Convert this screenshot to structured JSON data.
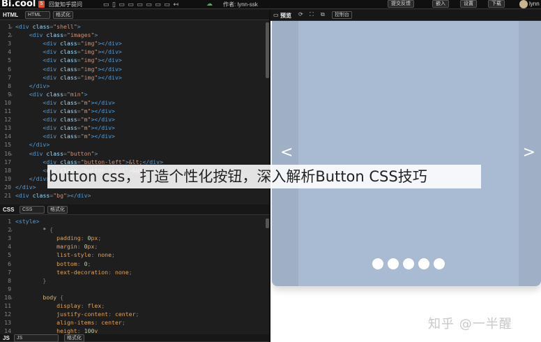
{
  "topbar": {
    "logo": "Bi.cool",
    "html5_badge": "5",
    "project_title": "回复知乎提问",
    "toolbar_glyphs": "▭ ▯ ▭ ▭ ▭ ▭ ▭ ▭ ↤",
    "author": "作者: lynn-ssk",
    "feedback_button": "提交反馈",
    "embed_button": "嵌入",
    "settings_button": "设置",
    "download_button": "下载",
    "username": "lynn"
  },
  "html_panel": {
    "label": "HTML",
    "lang_select": "HTML",
    "format_button": "格式化",
    "lines": [
      [
        [
          "tag",
          "<div "
        ],
        [
          "attr",
          "class"
        ],
        [
          "punc",
          "="
        ],
        [
          "str",
          "\"shell\""
        ],
        [
          "tag",
          ">"
        ]
      ],
      [
        [
          "tag",
          "    <div "
        ],
        [
          "attr",
          "class"
        ],
        [
          "punc",
          "="
        ],
        [
          "str",
          "\"images\""
        ],
        [
          "tag",
          ">"
        ]
      ],
      [
        [
          "tag",
          "        <div "
        ],
        [
          "attr",
          "class"
        ],
        [
          "punc",
          "="
        ],
        [
          "str",
          "\"img\""
        ],
        [
          "tag",
          "></div>"
        ]
      ],
      [
        [
          "tag",
          "        <div "
        ],
        [
          "attr",
          "class"
        ],
        [
          "punc",
          "="
        ],
        [
          "str",
          "\"img\""
        ],
        [
          "tag",
          "></div>"
        ]
      ],
      [
        [
          "tag",
          "        <div "
        ],
        [
          "attr",
          "class"
        ],
        [
          "punc",
          "="
        ],
        [
          "str",
          "\"img\""
        ],
        [
          "tag",
          "></div>"
        ]
      ],
      [
        [
          "tag",
          "        <div "
        ],
        [
          "attr",
          "class"
        ],
        [
          "punc",
          "="
        ],
        [
          "str",
          "\"img\""
        ],
        [
          "tag",
          "></div>"
        ]
      ],
      [
        [
          "tag",
          "        <div "
        ],
        [
          "attr",
          "class"
        ],
        [
          "punc",
          "="
        ],
        [
          "str",
          "\"img\""
        ],
        [
          "tag",
          "></div>"
        ]
      ],
      [
        [
          "tag",
          "    </div>"
        ]
      ],
      [
        [
          "tag",
          "    <div "
        ],
        [
          "attr",
          "class"
        ],
        [
          "punc",
          "="
        ],
        [
          "str",
          "\"min\""
        ],
        [
          "tag",
          ">"
        ]
      ],
      [
        [
          "tag",
          "        <div "
        ],
        [
          "attr",
          "class"
        ],
        [
          "punc",
          "="
        ],
        [
          "str",
          "\"m\""
        ],
        [
          "tag",
          "></div>"
        ]
      ],
      [
        [
          "tag",
          "        <div "
        ],
        [
          "attr",
          "class"
        ],
        [
          "punc",
          "="
        ],
        [
          "str",
          "\"m\""
        ],
        [
          "tag",
          "></div>"
        ]
      ],
      [
        [
          "tag",
          "        <div "
        ],
        [
          "attr",
          "class"
        ],
        [
          "punc",
          "="
        ],
        [
          "str",
          "\"m\""
        ],
        [
          "tag",
          "></div>"
        ]
      ],
      [
        [
          "tag",
          "        <div "
        ],
        [
          "attr",
          "class"
        ],
        [
          "punc",
          "="
        ],
        [
          "str",
          "\"m\""
        ],
        [
          "tag",
          "></div>"
        ]
      ],
      [
        [
          "tag",
          "        <div "
        ],
        [
          "attr",
          "class"
        ],
        [
          "punc",
          "="
        ],
        [
          "str",
          "\"m\""
        ],
        [
          "tag",
          "></div>"
        ]
      ],
      [
        [
          "tag",
          "    </div>"
        ]
      ],
      [
        [
          "tag",
          "    <div "
        ],
        [
          "attr",
          "class"
        ],
        [
          "punc",
          "="
        ],
        [
          "str",
          "\"button\""
        ],
        [
          "tag",
          ">"
        ]
      ],
      [
        [
          "tag",
          "        <div "
        ],
        [
          "attr",
          "class"
        ],
        [
          "punc",
          "="
        ],
        [
          "str",
          "\"button-left\""
        ],
        [
          "tag",
          ">"
        ],
        [
          "str",
          "&lt;"
        ],
        [
          "tag",
          "</div>"
        ]
      ],
      [
        [
          "tag",
          "        <div "
        ],
        [
          "attr",
          "class"
        ],
        [
          "punc",
          "="
        ],
        [
          "str",
          "\"button-right\""
        ],
        [
          "tag",
          ">"
        ],
        [
          "str",
          "&gt;"
        ],
        [
          "tag",
          "</div>"
        ]
      ],
      [
        [
          "tag",
          "    </div>"
        ]
      ],
      [
        [
          "tag",
          "</div>"
        ]
      ],
      [
        [
          "tag",
          "<div "
        ],
        [
          "attr",
          "class"
        ],
        [
          "punc",
          "="
        ],
        [
          "str",
          "\"bg\""
        ],
        [
          "tag",
          "></div>"
        ]
      ]
    ],
    "line_numbers": [
      "1",
      "2",
      "3",
      "4",
      "5",
      "6",
      "7",
      "8",
      "9",
      "10",
      "11",
      "12",
      "13",
      "14",
      "15",
      "16",
      "17",
      "18",
      "19",
      "20",
      "21"
    ],
    "fold_lines": [
      "1",
      "2",
      "9",
      "16"
    ]
  },
  "css_panel": {
    "label": "CSS",
    "lang_select": "CSS",
    "format_button": "格式化",
    "lines": [
      [
        [
          "tag",
          "<style>"
        ]
      ],
      [
        [
          "sel",
          "        * "
        ],
        [
          "punc",
          "{"
        ]
      ],
      [
        [
          "prop",
          "            padding"
        ],
        [
          "punc",
          ": "
        ],
        [
          "num",
          "0"
        ],
        [
          "prop",
          "px"
        ],
        [
          "punc",
          ";"
        ]
      ],
      [
        [
          "prop",
          "            margin"
        ],
        [
          "punc",
          ": "
        ],
        [
          "num",
          "0"
        ],
        [
          "prop",
          "px"
        ],
        [
          "punc",
          ";"
        ]
      ],
      [
        [
          "prop",
          "            list-style"
        ],
        [
          "punc",
          ": "
        ],
        [
          "prop",
          "none"
        ],
        [
          "punc",
          ";"
        ]
      ],
      [
        [
          "prop",
          "            bottom"
        ],
        [
          "punc",
          ": "
        ],
        [
          "num",
          "0"
        ],
        [
          "punc",
          ";"
        ]
      ],
      [
        [
          "prop",
          "            text-decoration"
        ],
        [
          "punc",
          ": "
        ],
        [
          "prop",
          "none"
        ],
        [
          "punc",
          ";"
        ]
      ],
      [
        [
          "punc",
          "        }"
        ]
      ],
      [
        [
          "punc",
          ""
        ]
      ],
      [
        [
          "sel",
          "        body "
        ],
        [
          "punc",
          "{"
        ]
      ],
      [
        [
          "prop",
          "            display"
        ],
        [
          "punc",
          ": "
        ],
        [
          "prop",
          "flex"
        ],
        [
          "punc",
          ";"
        ]
      ],
      [
        [
          "prop",
          "            justify-content"
        ],
        [
          "punc",
          ": "
        ],
        [
          "prop",
          "center"
        ],
        [
          "punc",
          ";"
        ]
      ],
      [
        [
          "prop",
          "            align-items"
        ],
        [
          "punc",
          ": "
        ],
        [
          "prop",
          "center"
        ],
        [
          "punc",
          ";"
        ]
      ],
      [
        [
          "prop",
          "            height"
        ],
        [
          "punc",
          ": "
        ],
        [
          "num",
          "100"
        ],
        [
          "prop",
          "v"
        ]
      ]
    ],
    "line_numbers": [
      "1",
      "2",
      "3",
      "4",
      "5",
      "6",
      "7",
      "8",
      "9",
      "10",
      "11",
      "12",
      "13",
      "14"
    ],
    "fold_lines": [
      "2",
      "10"
    ]
  },
  "js_panel": {
    "label": "JS",
    "lang_select": "JS",
    "format_button": "格式化"
  },
  "preview": {
    "tab_label": "预览",
    "console_label": "控制台",
    "left_arrow": "<",
    "right_arrow": ">",
    "dot_count": 5,
    "watermark": "知乎 @一半醒"
  },
  "overlay_title": "button css，打造个性化按钮，深入解析Button CSS技巧",
  "colors": {
    "slider_bg": "#9fb0c6",
    "slide_inner": "#a9bbd3",
    "editor_bg": "#1e1e1e"
  }
}
